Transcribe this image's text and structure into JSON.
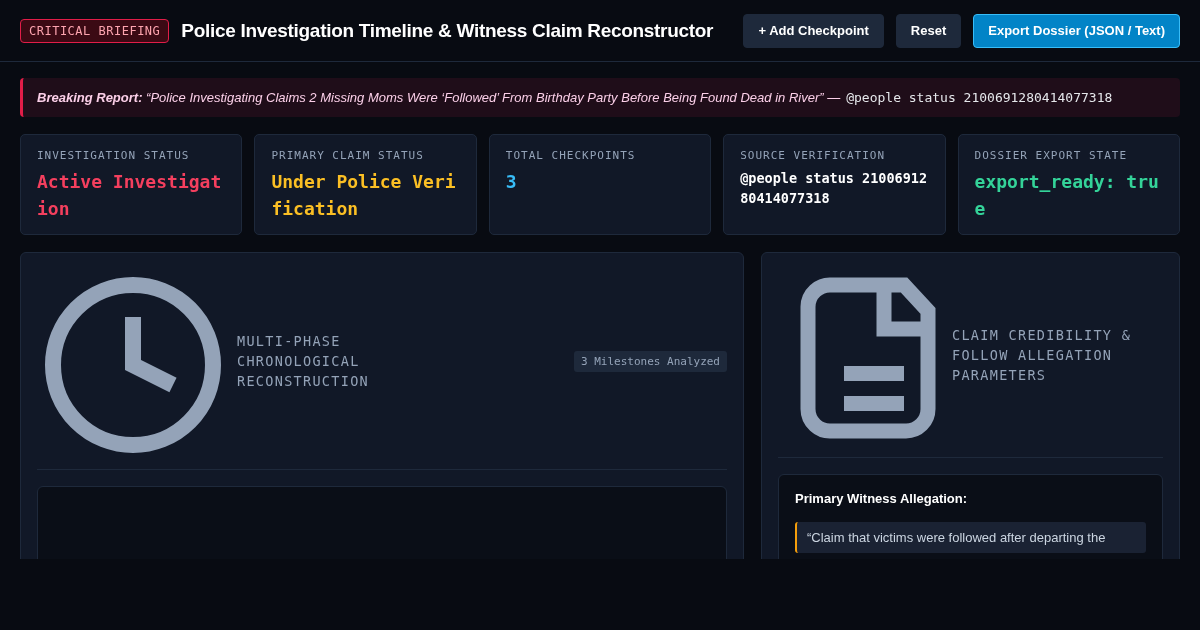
{
  "header": {
    "badge": "CRITICAL BRIEFING",
    "title": "Police Investigation Timeline & Witness Claim Reconstructor",
    "buttons": [
      {
        "label": "+ Add Checkpoint",
        "kind": "secondary"
      },
      {
        "label": "Reset",
        "kind": "secondary"
      },
      {
        "label": "Export Dossier (JSON / Text)",
        "kind": "primary"
      }
    ]
  },
  "banner": {
    "text": "**Breaking Report:** “Police Investigating Claims 2 Missing Moms Were ‘Followed’ From Birthday Party Before Being Found Dead in River” —",
    "source": "@people status 2100691280414077318"
  },
  "stats": [
    {
      "label": "INVESTIGATION STATUS",
      "value": "Active Investigation",
      "color": "#f43f5e"
    },
    {
      "label": "PRIMARY CLAIM STATUS",
      "value": "Under Police Verification",
      "color": "#fbbf24"
    },
    {
      "label": "TOTAL CHECKPOINTS",
      "value": "3",
      "color": "#38bdf8"
    },
    {
      "label": "SOURCE VERIFICATION",
      "value": "@people status 2100691280414077318",
      "color": "#ffffff"
    },
    {
      "label": "DOSSIER EXPORT STATE",
      "value": "export_ready: true",
      "color": "#34d399"
    }
  ],
  "timeline_panel": {
    "title": "MULTI-PHASE CHRONOLOGICAL RECONSTRUCTION",
    "badge": "3 Milestones Analyzed"
  },
  "claim_panel": {
    "title": "CLAIM CREDIBILITY & FOLLOW ALLEGATION PARAMETERS",
    "heading": "Primary Witness Allegation:",
    "quote": "“Claim that victims were followed after departing the"
  }
}
